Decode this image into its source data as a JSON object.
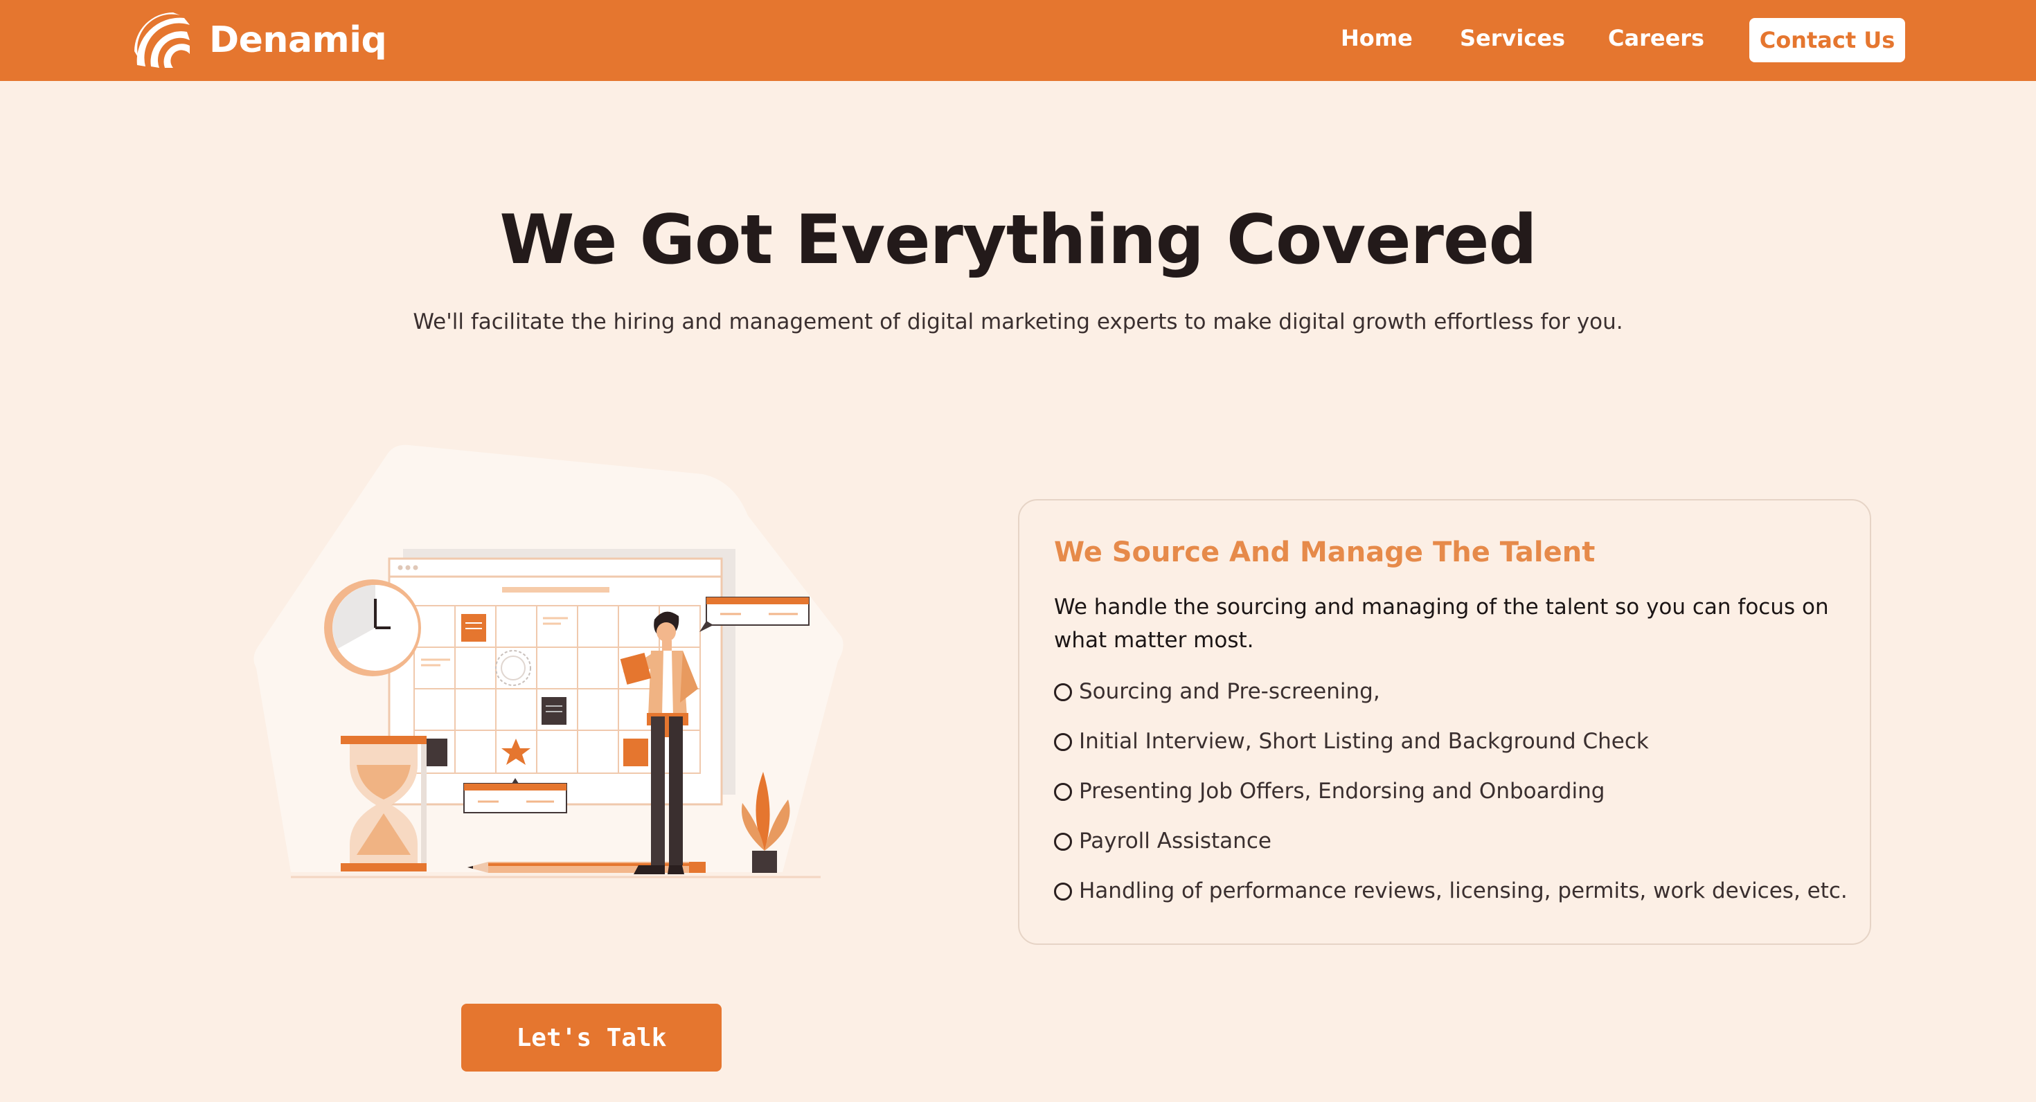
{
  "colors": {
    "brand": "#e5762f",
    "page_background": "#fcefe5",
    "accent_title": "#e68a4a",
    "heading": "#231a1a"
  },
  "header": {
    "logo_icon": "denamiq-logo-icon",
    "brand_name": "Denamiq",
    "nav": {
      "home": "Home",
      "services": "Services",
      "careers": "Careers",
      "contact": "Contact Us"
    }
  },
  "hero": {
    "title": "We Got Everything Covered",
    "subtitle": "We'll facilitate the hiring and management of digital marketing experts to make digital growth effortless for you."
  },
  "illustration": {
    "icon": "calendar-planning-illustration"
  },
  "card": {
    "title": "We Source And Manage The Talent",
    "description": "We handle the sourcing and managing of the talent so you can focus on what matter most.",
    "items": [
      "Sourcing and Pre-screening,",
      "Initial Interview, Short Listing and Background Check",
      "Presenting Job Offers, Endorsing and Onboarding",
      "Payroll Assistance",
      "Handling of performance reviews, licensing, permits, work devices, etc."
    ]
  },
  "cta": {
    "label": "Let's Talk"
  }
}
